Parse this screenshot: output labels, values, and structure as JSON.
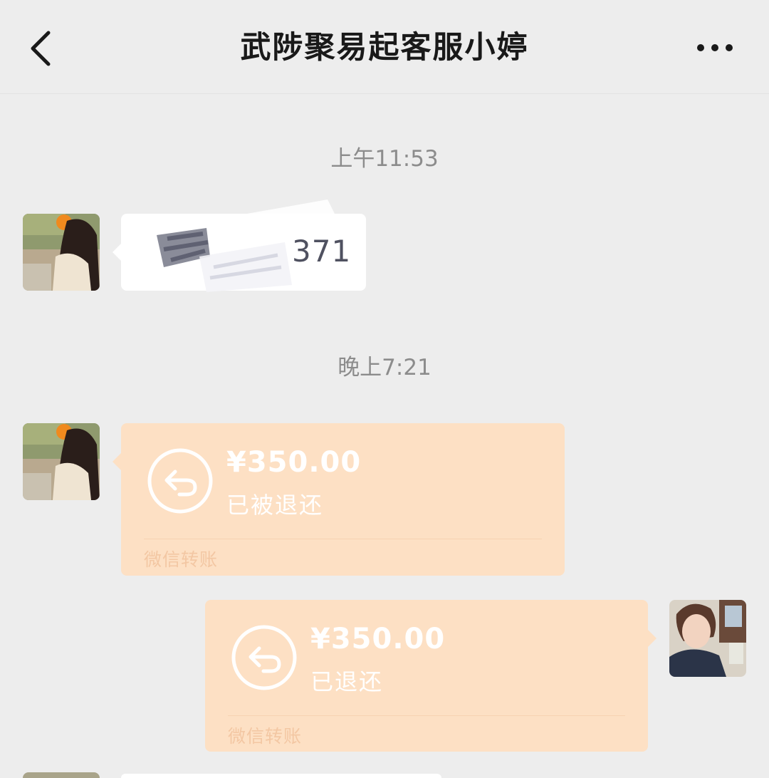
{
  "header": {
    "title": "武陟聚易起客服小婷",
    "back_icon": "chevron-left-icon",
    "more_icon": "more-dots-icon"
  },
  "messages": [
    {
      "type": "timestamp",
      "text": "上午11:53"
    },
    {
      "type": "text",
      "side": "left",
      "visible_text": "371"
    },
    {
      "type": "timestamp",
      "text": "晚上7:21"
    },
    {
      "type": "transfer",
      "side": "left",
      "amount": "¥350.00",
      "status": "已被退还",
      "label": "微信转账",
      "icon": "return-arrow-icon"
    },
    {
      "type": "transfer",
      "side": "right",
      "amount": "¥350.00",
      "status": "已退还",
      "label": "微信转账",
      "icon": "return-arrow-icon"
    }
  ],
  "colors": {
    "background": "#ededed",
    "transfer_bubble": "#fde0c4",
    "text_bubble": "#ffffff",
    "timestamp": "#8c8c8c"
  }
}
